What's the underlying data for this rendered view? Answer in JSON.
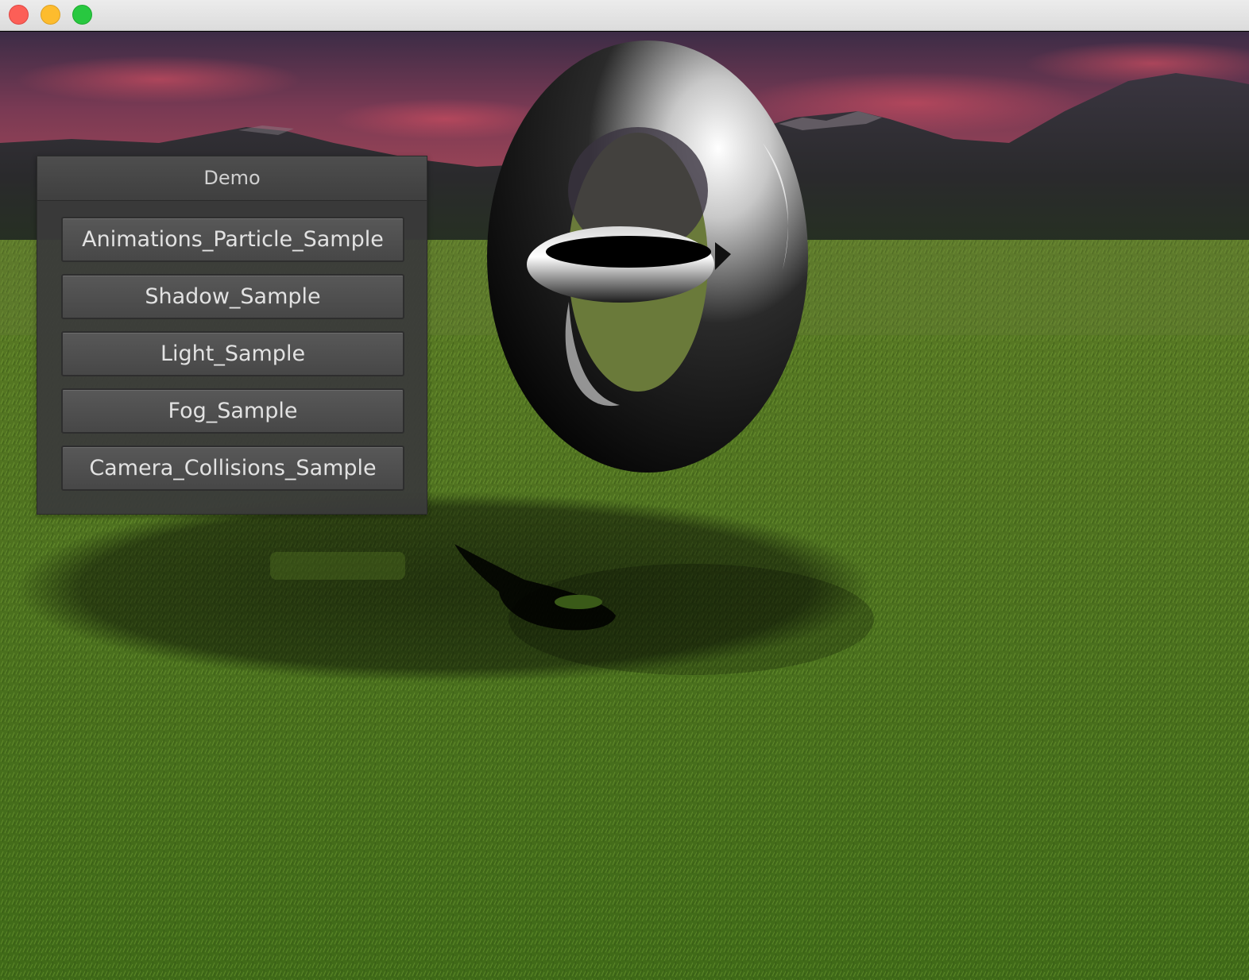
{
  "window": {
    "controls": [
      {
        "name": "close",
        "color": "#fc5f57"
      },
      {
        "name": "minimize",
        "color": "#fdbc2e"
      },
      {
        "name": "zoom",
        "color": "#28c840"
      }
    ]
  },
  "scene": {
    "sky_color": "#7a3a52",
    "ground_color": "#4f7a22",
    "objects": [
      "outer-torus",
      "inner-torus",
      "ground-shadow"
    ]
  },
  "demo_panel": {
    "title": "Demo",
    "buttons": [
      {
        "label": "Animations_Particle_Sample"
      },
      {
        "label": "Shadow_Sample"
      },
      {
        "label": "Light_Sample"
      },
      {
        "label": "Fog_Sample"
      },
      {
        "label": "Camera_Collisions_Sample"
      }
    ]
  }
}
